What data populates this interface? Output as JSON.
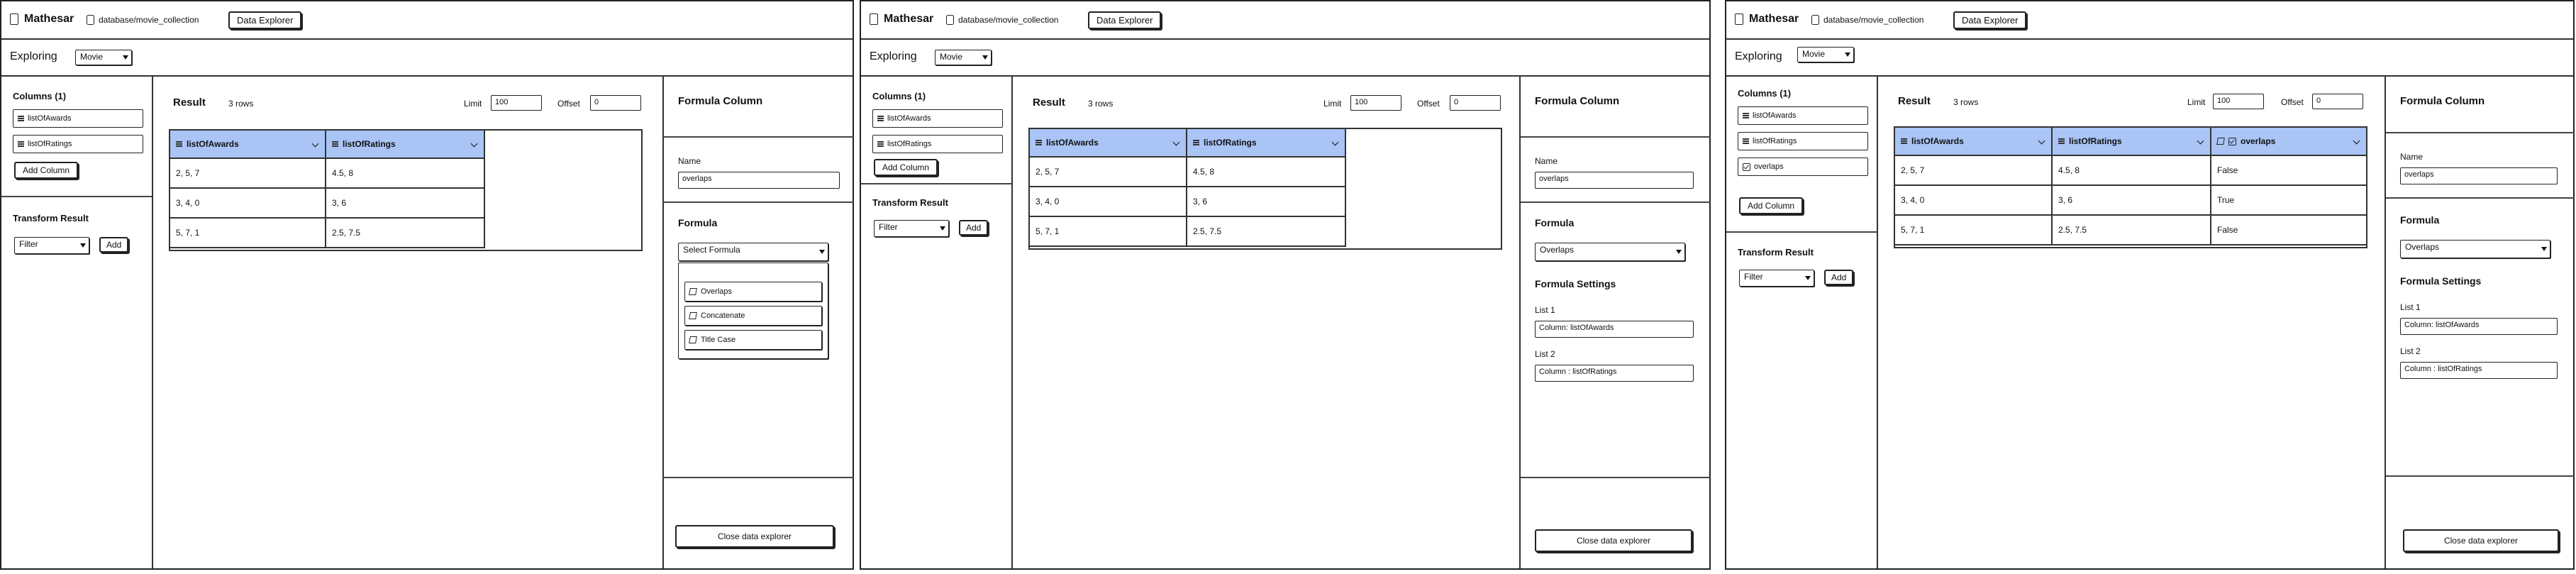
{
  "app": {
    "name": "Mathesar",
    "breadcrumb": "database/movie_collection",
    "data_explorer_btn": "Data Explorer"
  },
  "explore": {
    "label": "Exploring",
    "table": "Movie"
  },
  "left": {
    "columns_title_1": "Columns (1)",
    "col_awards": "listOfAwards",
    "col_ratings": "listOfRatings",
    "col_overlaps": "overlaps",
    "add_column": "Add Column",
    "transform_title": "Transform Result",
    "filter": "Filter",
    "add": "Add"
  },
  "result": {
    "title": "Result",
    "rows": "3 rows",
    "limit_label": "Limit",
    "limit_value": "100",
    "offset_label": "Offset",
    "offset_value": "0",
    "headers": [
      "listOfAwards",
      "listOfRatings",
      "overlaps"
    ],
    "data": [
      [
        "2, 5, 7",
        "4.5, 8",
        "False"
      ],
      [
        "3, 4, 0",
        "3, 6",
        "True"
      ],
      [
        "5, 7, 1",
        "2.5, 7.5",
        "False"
      ]
    ]
  },
  "formula": {
    "title": "Formula Column",
    "name_label": "Name",
    "name_value": "overlaps",
    "formula_label": "Formula",
    "select_placeholder": "Select Formula",
    "selected": "Overlaps",
    "options": [
      "Overlaps",
      "Concatenate",
      "Title Case"
    ],
    "settings_title": "Formula Settings",
    "list1_label": "List 1",
    "list1_value": "Column: listOfAwards",
    "list2_label": "List 2",
    "list2_value": "Column : listOfRatings",
    "close": "Close data explorer"
  }
}
